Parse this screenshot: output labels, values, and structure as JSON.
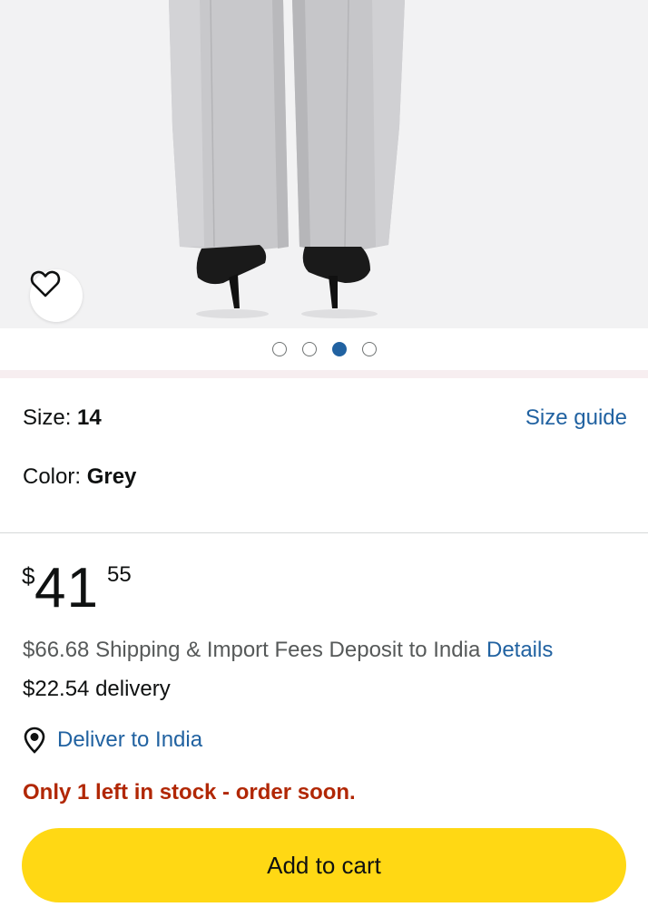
{
  "product_image": {
    "icon": "product-photo-grey-trousers",
    "wishlist_icon": "heart-icon",
    "carousel": {
      "count": 4,
      "active_index": 2
    }
  },
  "variant": {
    "size_label": "Size: ",
    "size_value": "14",
    "size_guide": "Size guide",
    "color_label": "Color: ",
    "color_value": "Grey"
  },
  "price": {
    "symbol": "$",
    "whole": "41",
    "fraction": "55"
  },
  "shipping": {
    "fees_text": "$66.68 Shipping & Import Fees Deposit to India ",
    "details_link": "Details",
    "delivery_text": "$22.54 delivery"
  },
  "deliver_to": {
    "icon": "location-pin-icon",
    "label": "Deliver to India"
  },
  "stock": {
    "message": "Only 1 left in stock - order soon."
  },
  "actions": {
    "add_to_cart": "Add to cart"
  },
  "colors": {
    "link": "#2162a1",
    "stock_warning": "#b12704",
    "add_to_cart_bg": "#ffd814"
  }
}
